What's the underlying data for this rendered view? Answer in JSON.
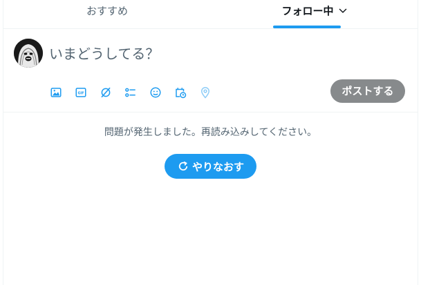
{
  "tabs": {
    "recommended": "おすすめ",
    "following": "フォロー中"
  },
  "composer": {
    "placeholder": "いまどうしてる？",
    "post_label": "ポストする",
    "toolbar_icons": [
      "media-icon",
      "gif-icon",
      "grok-icon",
      "poll-icon",
      "emoji-icon",
      "schedule-icon",
      "location-icon"
    ]
  },
  "error": {
    "message": "問題が発生しました。再読み込みしてください。",
    "retry_label": "やりなおす"
  },
  "colors": {
    "accent": "#1d9bf0",
    "post_disabled": "#878a8c",
    "secondary_text": "#536471"
  }
}
